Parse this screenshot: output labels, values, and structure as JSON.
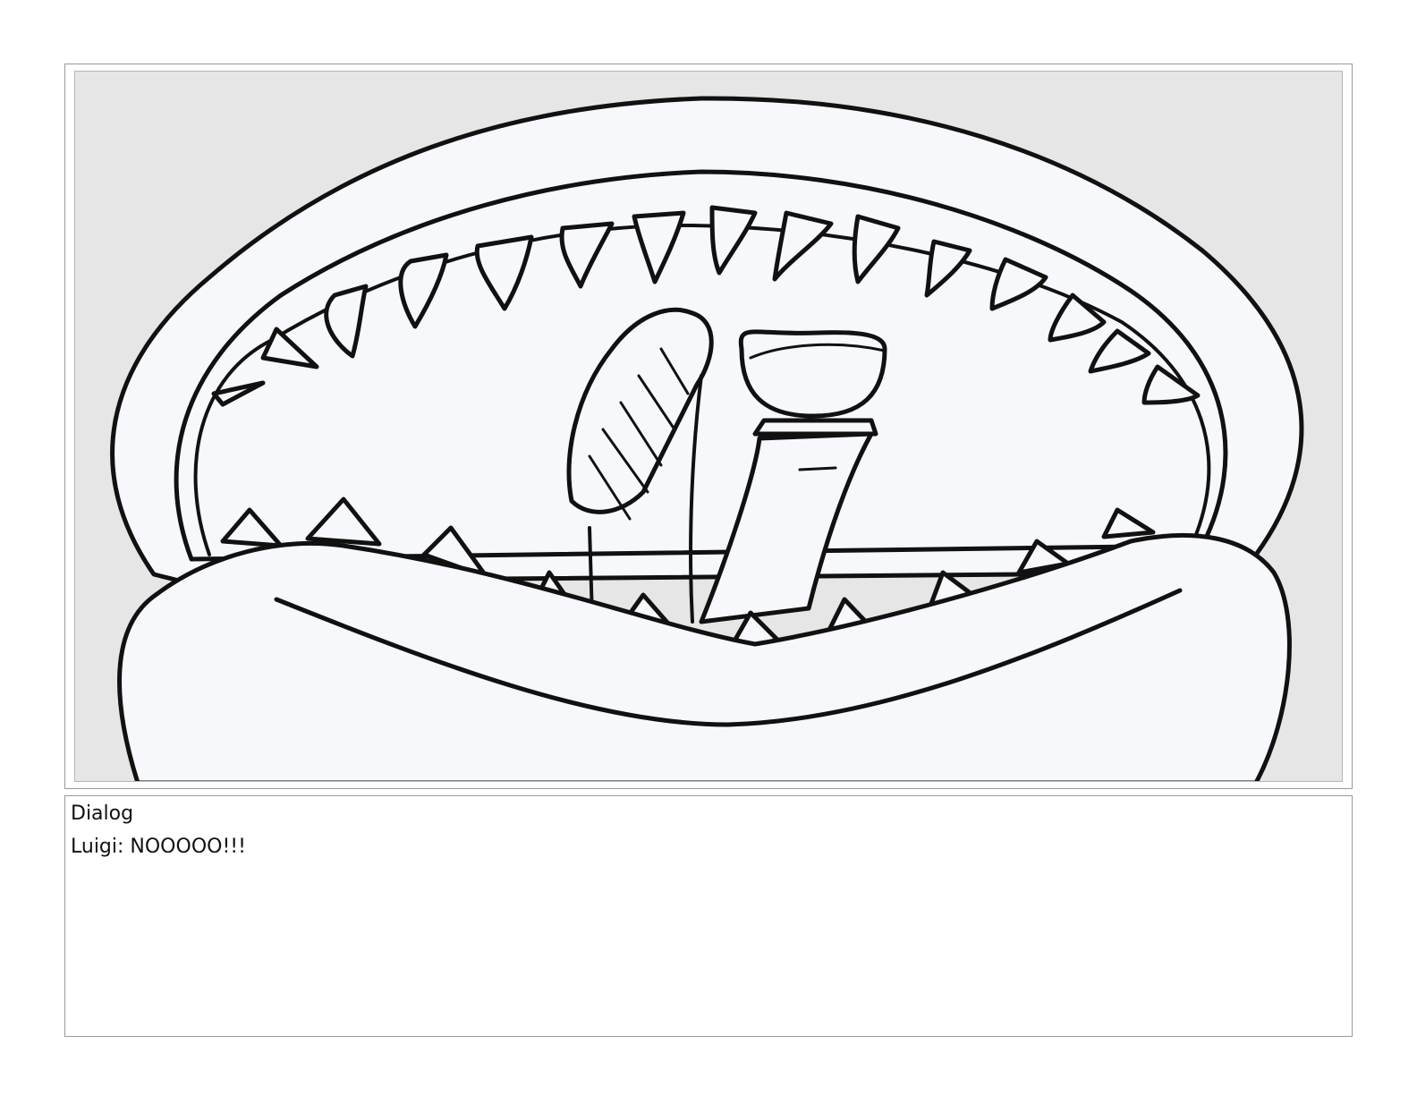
{
  "panel": {
    "background_color": "#e6e6e6",
    "ink_color": "#111111",
    "fill_color": "#f6f8fc"
  },
  "dialog": {
    "heading": "Dialog",
    "text": "Luigi: NOOOOO!!!"
  }
}
